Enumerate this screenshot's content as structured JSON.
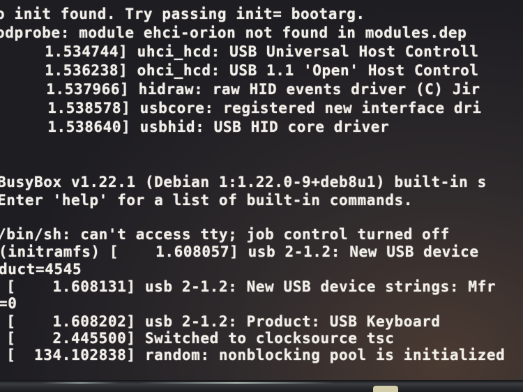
{
  "console": {
    "lines": [
      "o init found. Try passing init= bootarg.",
      "odprobe: module ehci-orion not found in modules.dep",
      "     1.534744] uhci_hcd: USB Universal Host Controll",
      "     1.536238] ohci_hcd: USB 1.1 'Open' Host Control",
      "     1.537966] hidraw: raw HID events driver (C) Jir",
      "     1.538578] usbcore: registered new interface dri",
      "     1.538640] usbhid: USB HID core driver",
      "BusyBox v1.22.1 (Debian 1:1.22.0-9+deb8u1) built-in s",
      "Enter 'help' for a list of built-in commands.",
      "/bin/sh: can't access tty; job control turned off",
      "(initramfs) [    1.608057] usb 2-1.2: New USB device",
      "duct=4545",
      " [    1.608131] usb 2-1.2: New USB device strings: Mfr",
      "=0",
      " [    1.608202] usb 2-1.2: Product: USB Keyboard",
      " [    2.445500] Switched to clocksource tsc",
      " [  134.102838] random: nonblocking pool is initialized"
    ]
  }
}
